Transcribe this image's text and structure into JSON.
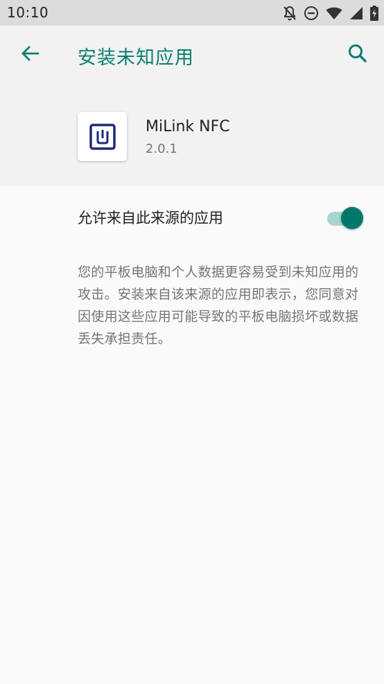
{
  "status_bar": {
    "time": "10:10",
    "icons": [
      "notifications-off-icon",
      "do-not-disturb-icon",
      "wifi-icon",
      "signal-icon",
      "battery-charging-icon"
    ]
  },
  "app_bar": {
    "title": "安装未知应用",
    "back_icon": "arrow-back-icon",
    "search_icon": "search-icon",
    "accent_color": "#0c7d72"
  },
  "app_info": {
    "name": "MiLink NFC",
    "version": "2.0.1",
    "icon": "nfc-app-icon"
  },
  "setting": {
    "label": "允许来自此来源的应用",
    "enabled": true
  },
  "description": "您的平板电脑和个人数据更容易受到未知应用的攻击。安装来自该来源的应用即表示，您同意对因使用这些应用可能导致的平板电脑损坏或数据丢失承担责任。"
}
